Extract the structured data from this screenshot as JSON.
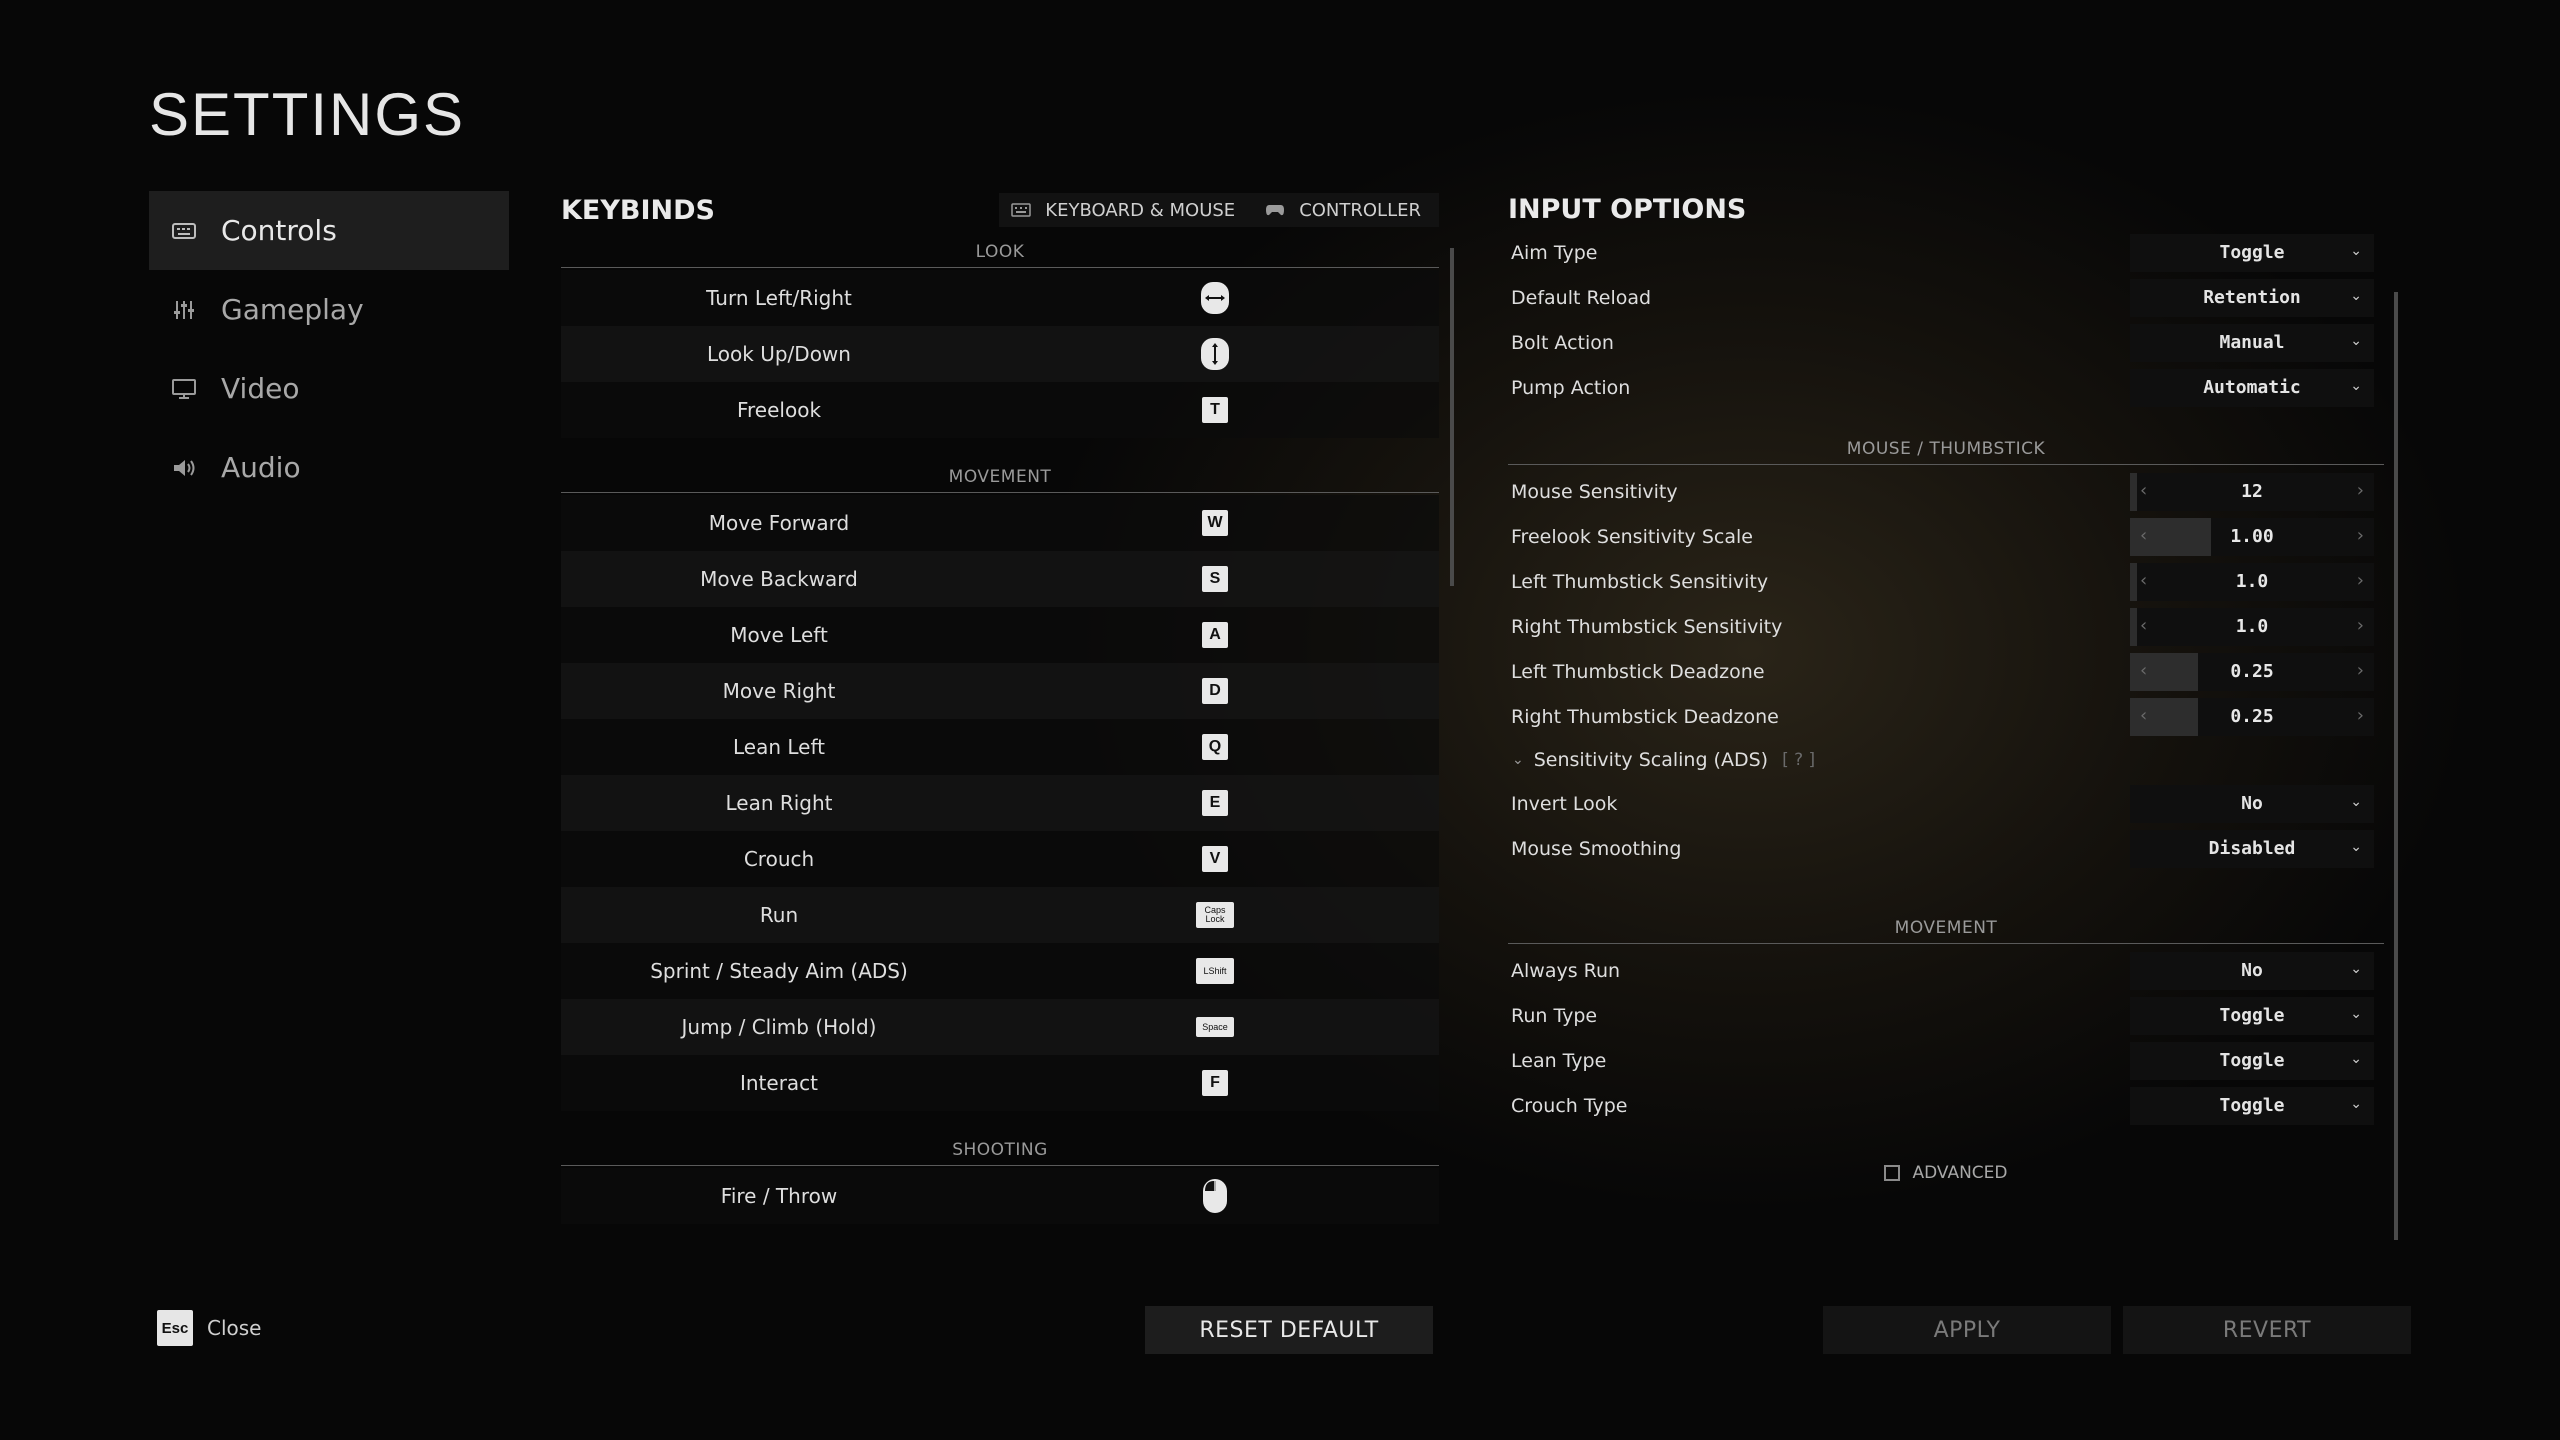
{
  "page_title": "SETTINGS",
  "nav": [
    {
      "label": "Controls",
      "icon": "keyboard-icon",
      "active": true
    },
    {
      "label": "Gameplay",
      "icon": "sliders-icon",
      "active": false
    },
    {
      "label": "Video",
      "icon": "monitor-icon",
      "active": false
    },
    {
      "label": "Audio",
      "icon": "speaker-icon",
      "active": false
    }
  ],
  "keybinds": {
    "title": "KEYBINDS",
    "tabs": [
      {
        "label": "KEYBOARD & MOUSE",
        "icon": "keyboard-icon"
      },
      {
        "label": "CONTROLLER",
        "icon": "gamepad-icon"
      }
    ],
    "sections": [
      {
        "name": "LOOK",
        "rows": [
          {
            "action": "Turn Left/Right",
            "key": "mouse-horizontal-icon"
          },
          {
            "action": "Look Up/Down",
            "key": "mouse-vertical-icon"
          },
          {
            "action": "Freelook",
            "key": "T"
          }
        ]
      },
      {
        "name": "MOVEMENT",
        "rows": [
          {
            "action": "Move Forward",
            "key": "W"
          },
          {
            "action": "Move Backward",
            "key": "S"
          },
          {
            "action": "Move Left",
            "key": "A"
          },
          {
            "action": "Move Right",
            "key": "D"
          },
          {
            "action": "Lean Left",
            "key": "Q"
          },
          {
            "action": "Lean Right",
            "key": "E"
          },
          {
            "action": "Crouch",
            "key": "V"
          },
          {
            "action": "Run",
            "key": "Caps Lock"
          },
          {
            "action": "Sprint / Steady Aim (ADS)",
            "key": "LShift"
          },
          {
            "action": "Jump / Climb (Hold)",
            "key": "Space"
          },
          {
            "action": "Interact",
            "key": "F"
          }
        ]
      },
      {
        "name": "SHOOTING",
        "rows": [
          {
            "action": "Fire / Throw",
            "key": "mouse-left-icon"
          }
        ]
      }
    ]
  },
  "input_options": {
    "title": "INPUT OPTIONS",
    "top_rows": [
      {
        "label": "Aim Type",
        "value": "Toggle"
      },
      {
        "label": "Default Reload",
        "value": "Retention"
      },
      {
        "label": "Bolt Action",
        "value": "Manual"
      },
      {
        "label": "Pump Action",
        "value": "Automatic"
      }
    ],
    "mouse_section": "MOUSE / THUMBSTICK",
    "sliders": [
      {
        "label": "Mouse Sensitivity",
        "value": "12",
        "fill": 0.03
      },
      {
        "label": "Freelook Sensitivity Scale",
        "value": "1.00",
        "fill": 0.33
      },
      {
        "label": "Left Thumbstick Sensitivity",
        "value": "1.0",
        "fill": 0.03
      },
      {
        "label": "Right Thumbstick Sensitivity",
        "value": "1.0",
        "fill": 0.03
      },
      {
        "label": "Left Thumbstick Deadzone",
        "value": "0.25",
        "fill": 0.28
      },
      {
        "label": "Right Thumbstick Deadzone",
        "value": "0.25",
        "fill": 0.28
      }
    ],
    "ads_scaling": {
      "label": "Sensitivity Scaling (ADS)",
      "help": "[ ? ]"
    },
    "mouse_dropdowns": [
      {
        "label": "Invert Look",
        "value": "No"
      },
      {
        "label": "Mouse Smoothing",
        "value": "Disabled"
      }
    ],
    "movement_section": "MOVEMENT",
    "movement_rows": [
      {
        "label": "Always Run",
        "value": "No"
      },
      {
        "label": "Run Type",
        "value": "Toggle"
      },
      {
        "label": "Lean Type",
        "value": "Toggle"
      },
      {
        "label": "Crouch Type",
        "value": "Toggle"
      }
    ],
    "advanced_label": "ADVANCED"
  },
  "footer": {
    "esc_key": "Esc",
    "close_label": "Close",
    "reset_label": "RESET DEFAULT",
    "apply_label": "APPLY",
    "revert_label": "REVERT"
  }
}
